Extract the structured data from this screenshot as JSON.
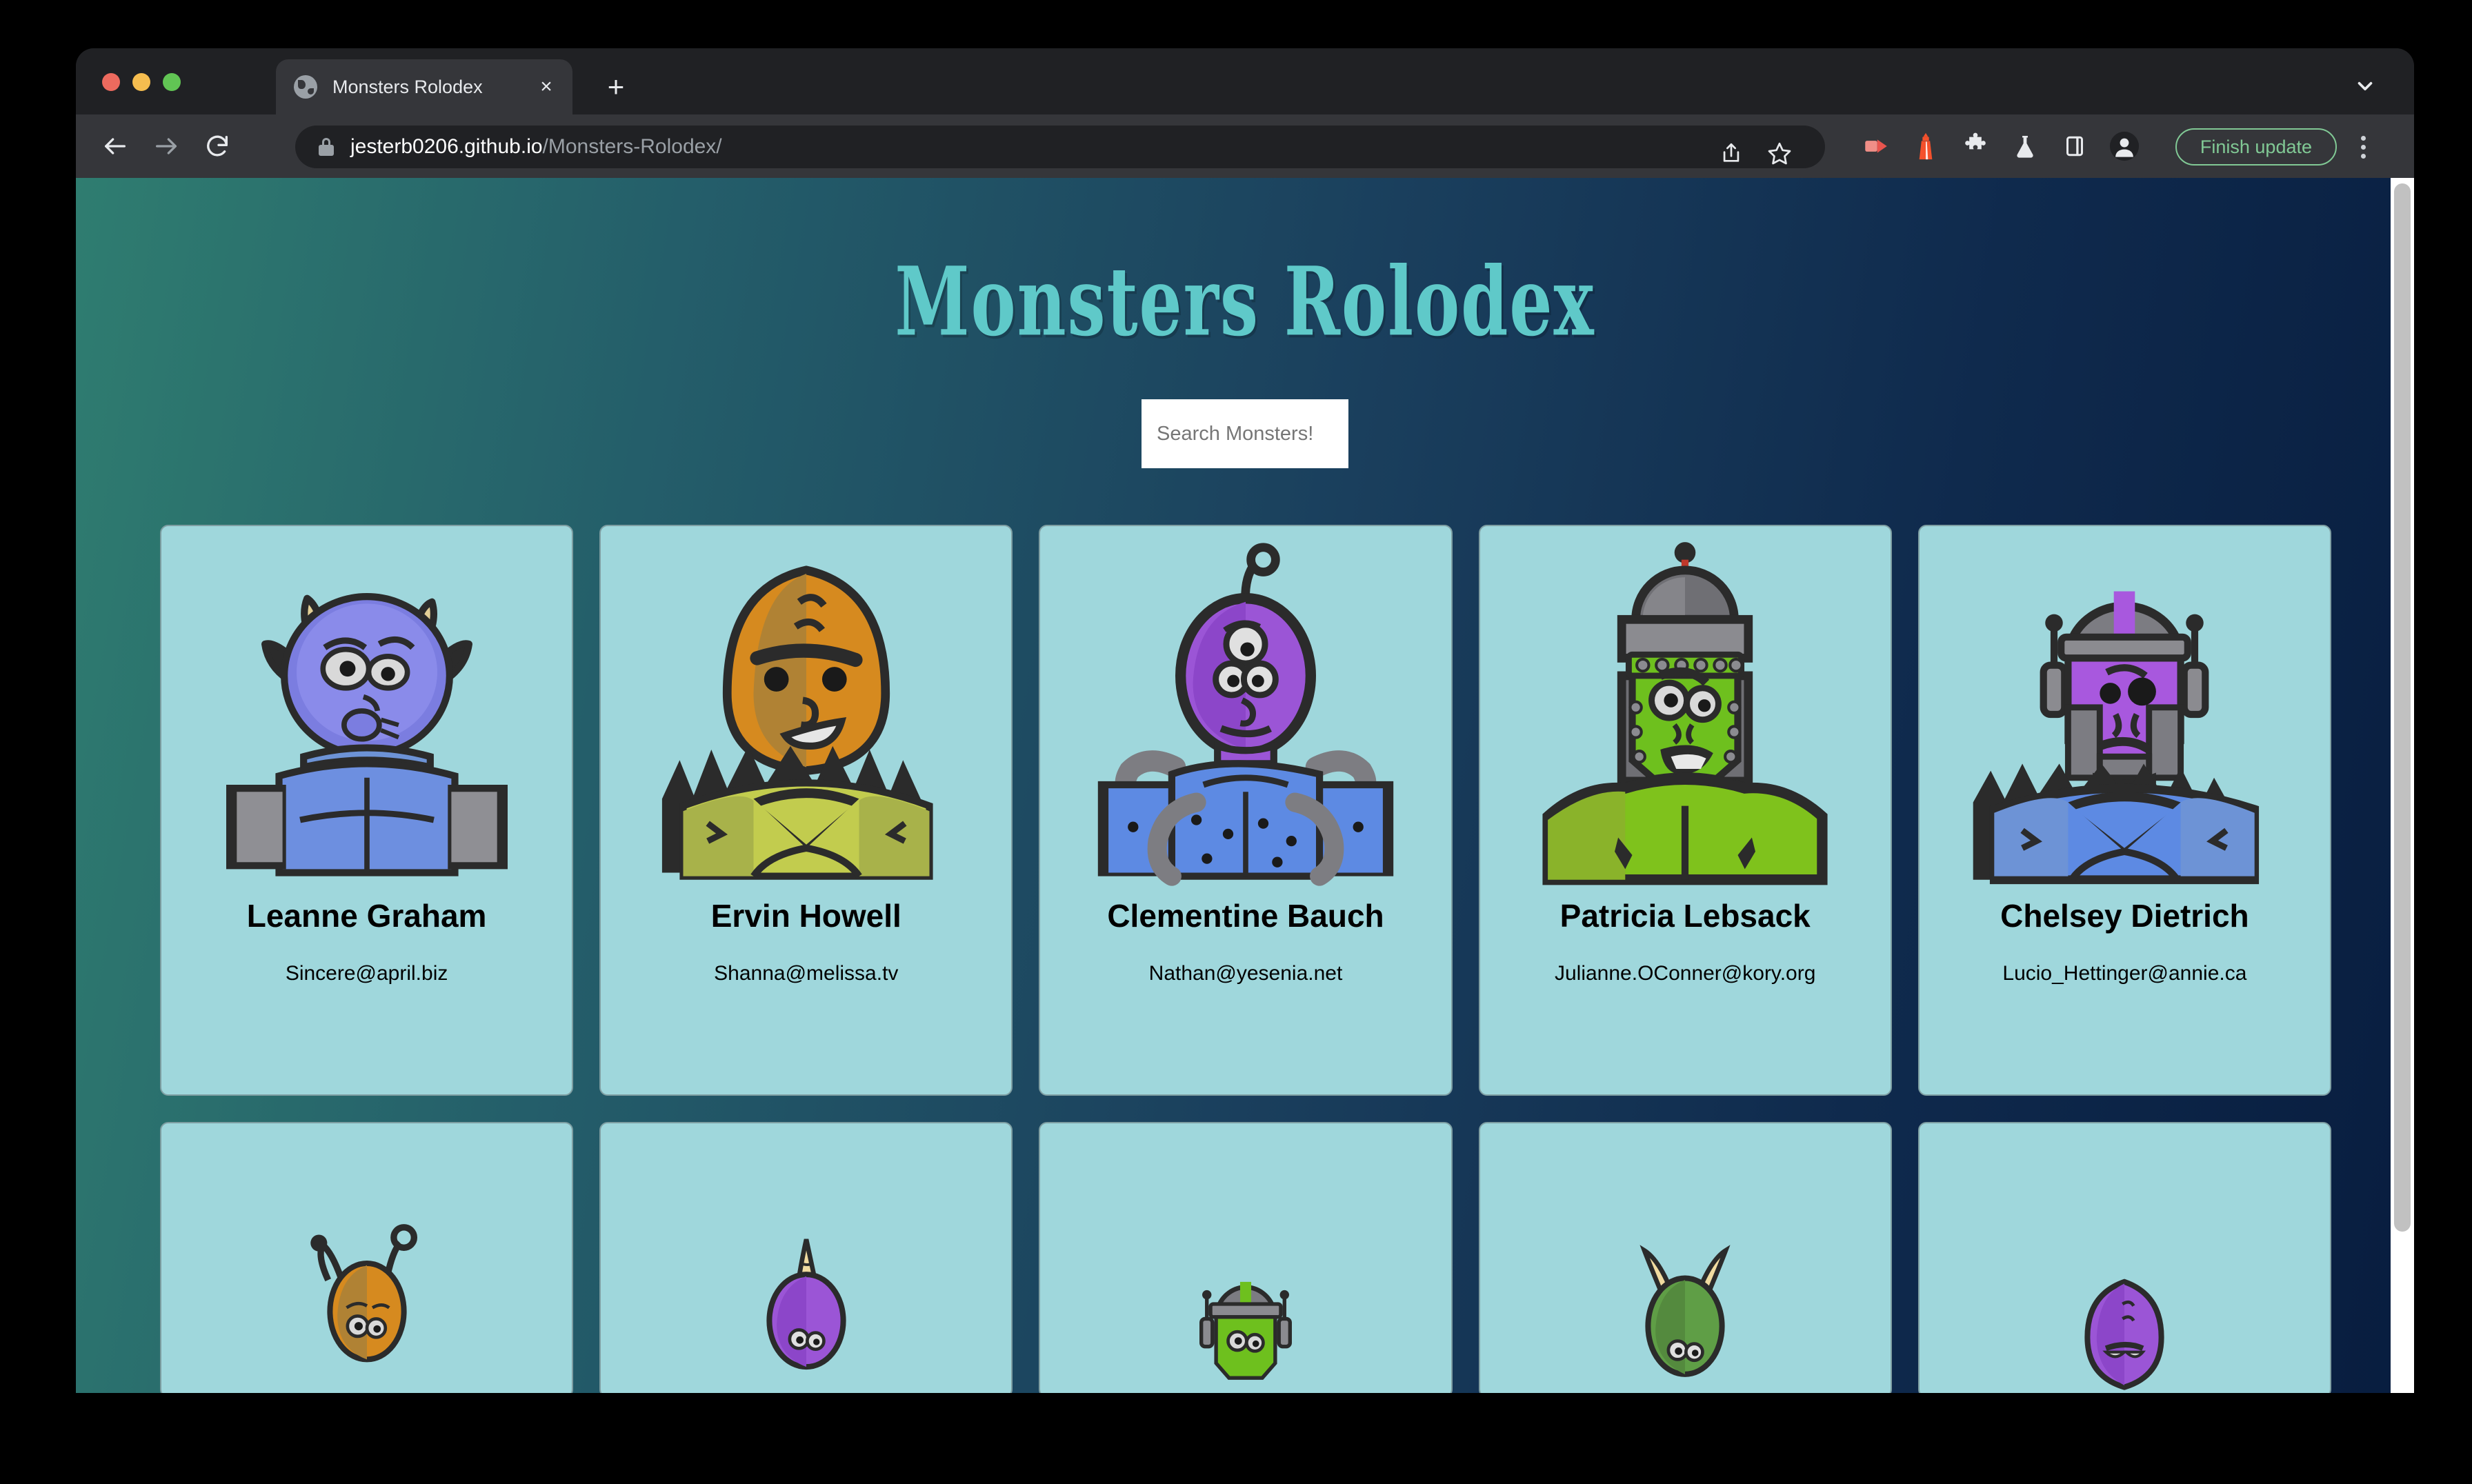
{
  "browser": {
    "tab": {
      "title": "Monsters Rolodex",
      "favicon": "globe-icon",
      "close_label": "×"
    },
    "new_tab_label": "+",
    "tab_search_icon": "chevron-down-icon",
    "nav": {
      "back_icon": "arrow-left-icon",
      "forward_icon": "arrow-right-icon",
      "reload_icon": "reload-icon"
    },
    "omnibox": {
      "lock_icon": "lock-icon",
      "url_host": "jesterb0206.github.io",
      "url_path": "/Monsters-Rolodex/",
      "share_icon": "share-icon",
      "bookmark_icon": "star-icon"
    },
    "extensions": [
      {
        "name": "screencast-icon",
        "color": "#e8554e"
      },
      {
        "name": "lighthouse-icon",
        "color": "#f4512c"
      },
      {
        "name": "puzzle-icon",
        "color": "#e8eaed"
      },
      {
        "name": "flask-icon",
        "color": "#e8eaed"
      },
      {
        "name": "side-panel-icon",
        "color": "#e8eaed"
      },
      {
        "name": "profile-avatar-icon",
        "color": "#e8eaed"
      }
    ],
    "finish_update_label": "Finish update",
    "menu_icon": "three-dot-menu-icon"
  },
  "page": {
    "title": "Monsters Rolodex",
    "search": {
      "placeholder": "Search Monsters!",
      "value": ""
    },
    "theme": {
      "bg_gradient_from": "#2f7d70",
      "bg_gradient_to": "#081d3f",
      "title_color": "#5fc9c9",
      "card_bg": "#9fd7dc",
      "card_border": "#7e9ea2"
    },
    "monsters": [
      {
        "name": "Leanne Graham",
        "email": "Sincere@april.biz",
        "art": "blue-horned-monster"
      },
      {
        "name": "Ervin Howell",
        "email": "Shanna@melissa.tv",
        "art": "orange-spiky-monster"
      },
      {
        "name": "Clementine Bauch",
        "email": "Nathan@yesenia.net",
        "art": "purple-three-eye-monster"
      },
      {
        "name": "Patricia Lebsack",
        "email": "Julianne.OConner@kory.org",
        "art": "green-helmet-monster"
      },
      {
        "name": "Chelsey Dietrich",
        "email": "Lucio_Hettinger@annie.ca",
        "art": "purple-cyborg-monster"
      }
    ],
    "monsters_row2": [
      {
        "art": "orange-antenna-monster"
      },
      {
        "art": "purple-horn-monster"
      },
      {
        "art": "green-visor-monster"
      },
      {
        "art": "green-twohorn-monster"
      },
      {
        "art": "purple-plain-monster"
      }
    ]
  }
}
